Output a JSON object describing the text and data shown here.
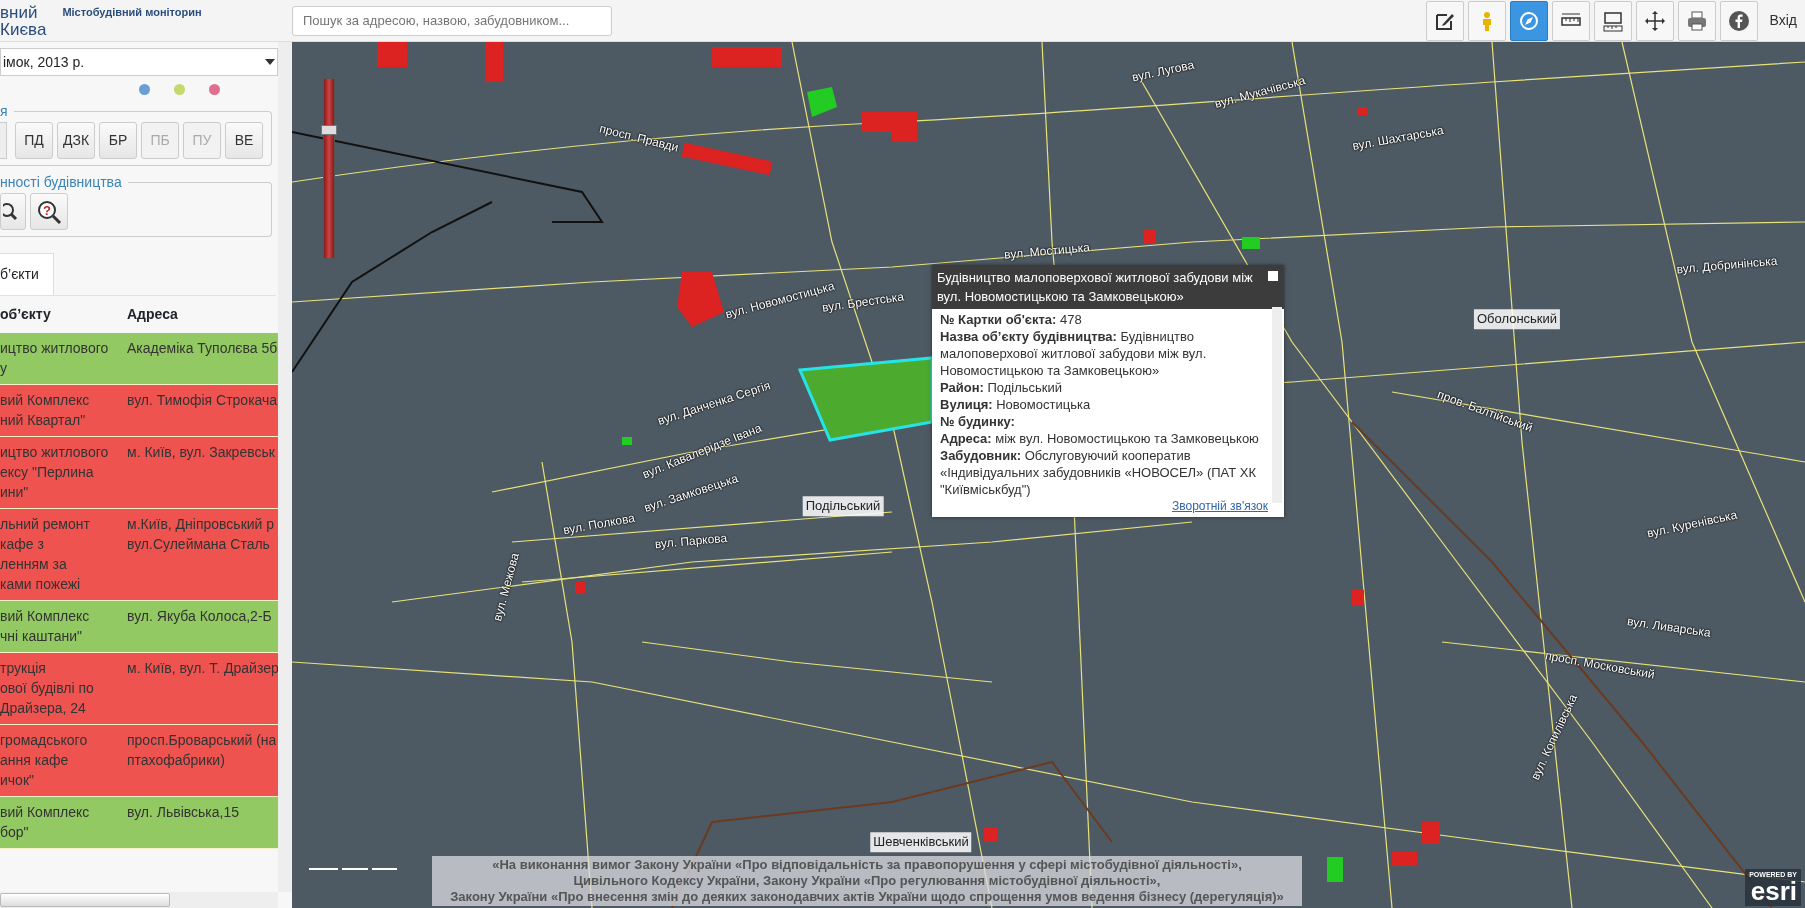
{
  "header": {
    "logo_lines": [
      "вний",
      "Києва"
    ],
    "subtitle": "Містобудівний моніторин"
  },
  "search": {
    "placeholder": "Пошук за адресою, назвою, забудовником..."
  },
  "toolbar": [
    {
      "kind": "edit",
      "selected": false
    },
    {
      "kind": "person",
      "selected": false
    },
    {
      "kind": "compass",
      "selected": true
    },
    {
      "kind": "ruler",
      "selected": false
    },
    {
      "kind": "area",
      "selected": false
    },
    {
      "kind": "move",
      "selected": false
    },
    {
      "kind": "printer",
      "selected": false
    },
    {
      "kind": "facebook",
      "selected": false
    }
  ],
  "login": "Вхід",
  "basemap": {
    "value": "імок, 2013 р."
  },
  "dots": [
    {
      "color": "#6a9fd4"
    },
    {
      "color": "#c3d96a"
    },
    {
      "color": "#de6f8f"
    }
  ],
  "filter": {
    "legend": "я",
    "buttons": [
      {
        "label": "ПД",
        "disabled": false
      },
      {
        "label": "ДЗК",
        "disabled": false
      },
      {
        "label": "БР",
        "disabled": false
      },
      {
        "label": "ПБ",
        "disabled": true
      },
      {
        "label": "ПУ",
        "disabled": true
      },
      {
        "label": "ВЕ",
        "disabled": false
      }
    ]
  },
  "check": {
    "legend": "нності будівництва",
    "help_glyph": "?"
  },
  "tabs": [
    {
      "label": "б’єкти",
      "selected": true
    }
  ],
  "table": {
    "columns": [
      "об’єкту",
      "Адреса"
    ],
    "rows": [
      {
        "color": "#93c962",
        "cells": [
          "ицтво житлового\nу",
          "Академіка Туполєва 5б"
        ]
      },
      {
        "color": "#ef5350",
        "cells": [
          "вий Комплекс\nний Квартал\"",
          "вул. Тимофія Строкача"
        ]
      },
      {
        "color": "#ef5350",
        "cells": [
          "ицтво житлового\nексу \"Перлина\nини\"",
          "м. Київ, вул. Закревськ"
        ]
      },
      {
        "color": "#ef5350",
        "cells": [
          "льний ремонт\nкафе з\nленням за\nками пожежі",
          "м.Київ, Дніпровський р\nвул.Сулеймана Сталь"
        ]
      },
      {
        "color": "#93c962",
        "cells": [
          "вий Комплекс\nчні каштани\"",
          "вул. Якуба Колоса,2-Б"
        ]
      },
      {
        "color": "#ef5350",
        "cells": [
          "трукція\nової будівлі по\nДрайзера, 24",
          "м. Київ, вул. Т. Драйзер"
        ]
      },
      {
        "color": "#ef5350",
        "cells": [
          "громадського\nання кафе\nичок\"",
          "просп.Броварський (на\nптахофабрики)"
        ]
      },
      {
        "color": "#93c962",
        "cells": [
          "вий Комплекс\nбор\"",
          "вул. Львівська,15"
        ]
      }
    ]
  },
  "map": {
    "zoom": {
      "level": 0.73
    },
    "labels": [
      {
        "text": "вул. Лугова"
      },
      {
        "text": "просп. Правди"
      },
      {
        "text": "вул. Мукачівська"
      },
      {
        "text": "вул. Шахтарська"
      },
      {
        "text": "вул. Мостицька"
      },
      {
        "text": "вул. Брестська"
      },
      {
        "text": "вул. Новомостицька"
      },
      {
        "text": "вул. Данченка Сергія"
      },
      {
        "text": "вул. Кавалерідзе Івана"
      },
      {
        "text": "вул. Замковецька"
      },
      {
        "text": "вул. Полкова"
      },
      {
        "text": "вул. Паркова"
      },
      {
        "text": "Подільський",
        "kind": "district"
      },
      {
        "text": "вул. Межова"
      },
      {
        "text": "Оболонський",
        "kind": "district"
      },
      {
        "text": "вул. Добринінська"
      },
      {
        "text": "пров. Балтійський"
      },
      {
        "text": "вул. Куренівська"
      },
      {
        "text": "вул. Ливарська"
      },
      {
        "text": "просп. Московський"
      },
      {
        "text": "вул. Копилівська"
      },
      {
        "text": "Шевченківський",
        "kind": "district"
      }
    ],
    "popup": {
      "title": "Будівництво малоповерхової житлової забудови між вул. Новомостицькою та Замковецькою»",
      "fields": [
        {
          "label": "№ Картки об'єкта:",
          "value": "478"
        },
        {
          "label": "Назва об’єкту будівництва:",
          "value": "Будівництво малоповерхової житлової забудови між вул. Новомостицькою та Замковецькою»"
        },
        {
          "label": "Район:",
          "value": "Подільський"
        },
        {
          "label": "Вулиця:",
          "value": "Новомостицька"
        },
        {
          "label": "№ будинку:"
        },
        {
          "label": "Адреса:",
          "value": "між вул. Новомостицькою та Замковецькою"
        },
        {
          "label": "Забудовник:",
          "value": "Обслуговуючий кооператив «Індивідуальних забудовників «НОВОСЕЛ» (ПАТ ХК \"Київміськбуд\")"
        }
      ],
      "link": "Зворотній зв'язок"
    },
    "legal": [
      "«На виконання вимог Закону України «Про відповідальність за правопорушення у сфері містобудівної діяльності»,",
      "Цивільного Кодексу України, Закону України «Про регулювання містобудівної діяльності»,",
      "Закону України «Про внесення змін до деяких законодавчих актів України щодо спрощення умов ведення бізнесу (дерегуляція)»"
    ],
    "attribution": {
      "top": "POWERED BY",
      "brand": "esri"
    }
  }
}
